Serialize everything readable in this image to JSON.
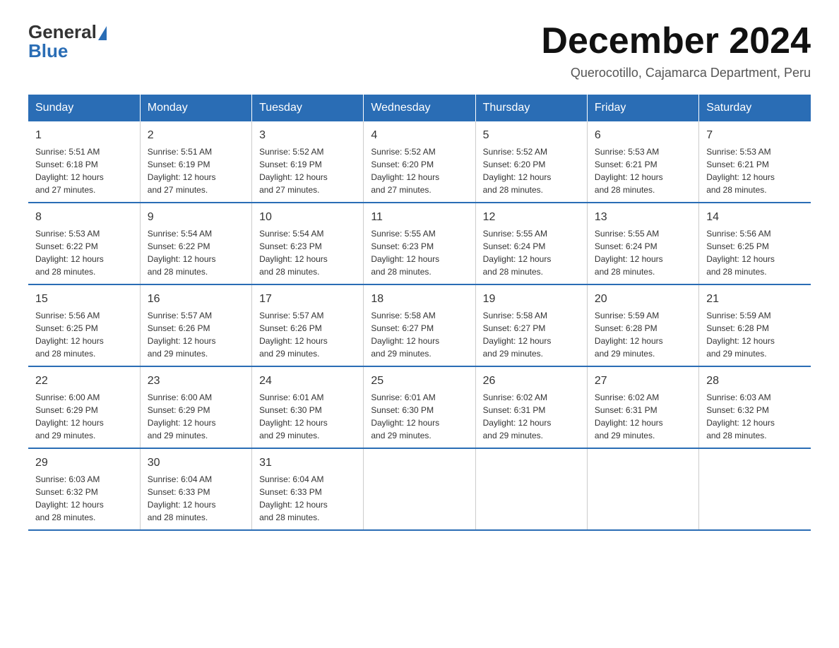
{
  "header": {
    "logo_general": "General",
    "logo_blue": "Blue",
    "main_title": "December 2024",
    "subtitle": "Querocotillo, Cajamarca Department, Peru"
  },
  "calendar": {
    "weekdays": [
      "Sunday",
      "Monday",
      "Tuesday",
      "Wednesday",
      "Thursday",
      "Friday",
      "Saturday"
    ],
    "weeks": [
      [
        {
          "day": "1",
          "sunrise": "5:51 AM",
          "sunset": "6:18 PM",
          "daylight": "12 hours and 27 minutes."
        },
        {
          "day": "2",
          "sunrise": "5:51 AM",
          "sunset": "6:19 PM",
          "daylight": "12 hours and 27 minutes."
        },
        {
          "day": "3",
          "sunrise": "5:52 AM",
          "sunset": "6:19 PM",
          "daylight": "12 hours and 27 minutes."
        },
        {
          "day": "4",
          "sunrise": "5:52 AM",
          "sunset": "6:20 PM",
          "daylight": "12 hours and 27 minutes."
        },
        {
          "day": "5",
          "sunrise": "5:52 AM",
          "sunset": "6:20 PM",
          "daylight": "12 hours and 28 minutes."
        },
        {
          "day": "6",
          "sunrise": "5:53 AM",
          "sunset": "6:21 PM",
          "daylight": "12 hours and 28 minutes."
        },
        {
          "day": "7",
          "sunrise": "5:53 AM",
          "sunset": "6:21 PM",
          "daylight": "12 hours and 28 minutes."
        }
      ],
      [
        {
          "day": "8",
          "sunrise": "5:53 AM",
          "sunset": "6:22 PM",
          "daylight": "12 hours and 28 minutes."
        },
        {
          "day": "9",
          "sunrise": "5:54 AM",
          "sunset": "6:22 PM",
          "daylight": "12 hours and 28 minutes."
        },
        {
          "day": "10",
          "sunrise": "5:54 AM",
          "sunset": "6:23 PM",
          "daylight": "12 hours and 28 minutes."
        },
        {
          "day": "11",
          "sunrise": "5:55 AM",
          "sunset": "6:23 PM",
          "daylight": "12 hours and 28 minutes."
        },
        {
          "day": "12",
          "sunrise": "5:55 AM",
          "sunset": "6:24 PM",
          "daylight": "12 hours and 28 minutes."
        },
        {
          "day": "13",
          "sunrise": "5:55 AM",
          "sunset": "6:24 PM",
          "daylight": "12 hours and 28 minutes."
        },
        {
          "day": "14",
          "sunrise": "5:56 AM",
          "sunset": "6:25 PM",
          "daylight": "12 hours and 28 minutes."
        }
      ],
      [
        {
          "day": "15",
          "sunrise": "5:56 AM",
          "sunset": "6:25 PM",
          "daylight": "12 hours and 28 minutes."
        },
        {
          "day": "16",
          "sunrise": "5:57 AM",
          "sunset": "6:26 PM",
          "daylight": "12 hours and 29 minutes."
        },
        {
          "day": "17",
          "sunrise": "5:57 AM",
          "sunset": "6:26 PM",
          "daylight": "12 hours and 29 minutes."
        },
        {
          "day": "18",
          "sunrise": "5:58 AM",
          "sunset": "6:27 PM",
          "daylight": "12 hours and 29 minutes."
        },
        {
          "day": "19",
          "sunrise": "5:58 AM",
          "sunset": "6:27 PM",
          "daylight": "12 hours and 29 minutes."
        },
        {
          "day": "20",
          "sunrise": "5:59 AM",
          "sunset": "6:28 PM",
          "daylight": "12 hours and 29 minutes."
        },
        {
          "day": "21",
          "sunrise": "5:59 AM",
          "sunset": "6:28 PM",
          "daylight": "12 hours and 29 minutes."
        }
      ],
      [
        {
          "day": "22",
          "sunrise": "6:00 AM",
          "sunset": "6:29 PM",
          "daylight": "12 hours and 29 minutes."
        },
        {
          "day": "23",
          "sunrise": "6:00 AM",
          "sunset": "6:29 PM",
          "daylight": "12 hours and 29 minutes."
        },
        {
          "day": "24",
          "sunrise": "6:01 AM",
          "sunset": "6:30 PM",
          "daylight": "12 hours and 29 minutes."
        },
        {
          "day": "25",
          "sunrise": "6:01 AM",
          "sunset": "6:30 PM",
          "daylight": "12 hours and 29 minutes."
        },
        {
          "day": "26",
          "sunrise": "6:02 AM",
          "sunset": "6:31 PM",
          "daylight": "12 hours and 29 minutes."
        },
        {
          "day": "27",
          "sunrise": "6:02 AM",
          "sunset": "6:31 PM",
          "daylight": "12 hours and 29 minutes."
        },
        {
          "day": "28",
          "sunrise": "6:03 AM",
          "sunset": "6:32 PM",
          "daylight": "12 hours and 28 minutes."
        }
      ],
      [
        {
          "day": "29",
          "sunrise": "6:03 AM",
          "sunset": "6:32 PM",
          "daylight": "12 hours and 28 minutes."
        },
        {
          "day": "30",
          "sunrise": "6:04 AM",
          "sunset": "6:33 PM",
          "daylight": "12 hours and 28 minutes."
        },
        {
          "day": "31",
          "sunrise": "6:04 AM",
          "sunset": "6:33 PM",
          "daylight": "12 hours and 28 minutes."
        },
        null,
        null,
        null,
        null
      ]
    ],
    "labels": {
      "sunrise": "Sunrise:",
      "sunset": "Sunset:",
      "daylight": "Daylight:"
    }
  }
}
